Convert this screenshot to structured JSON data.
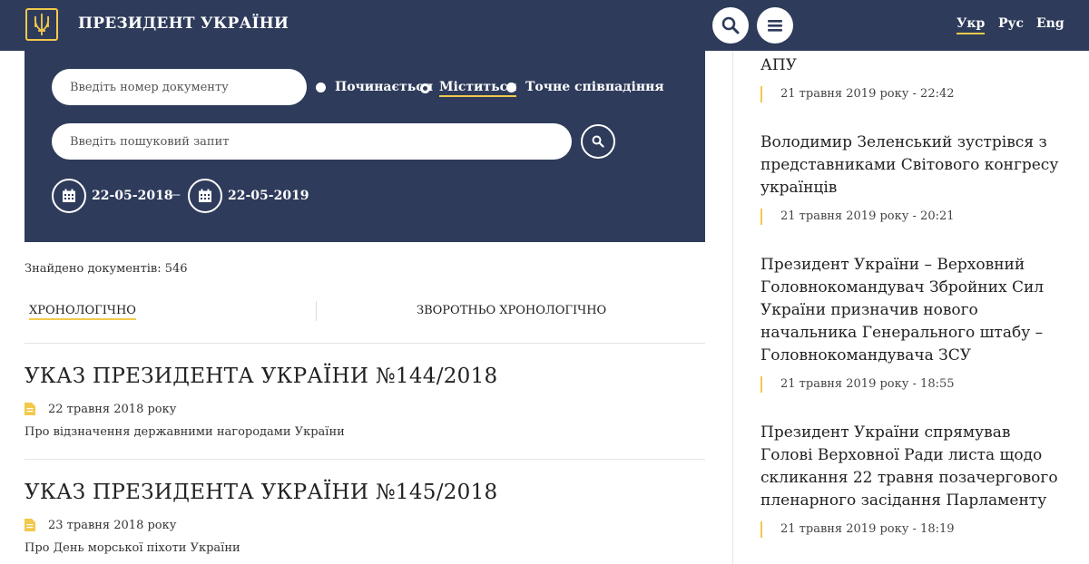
{
  "header": {
    "site_title": "ПРЕЗИДЕНТ УКРАЇНИ",
    "languages": [
      "Укр",
      "Рус",
      "Eng"
    ],
    "active_language": "Укр",
    "icons": {
      "search": "search-icon",
      "menu": "menu-icon",
      "logo": "trident-icon"
    }
  },
  "search": {
    "doc_number_placeholder": "Введіть номер документу",
    "query_placeholder": "Введіть пошуковий запит",
    "match_options": [
      "Починається",
      "Міститься",
      "Точне співпадіння"
    ],
    "selected_match": "Міститься",
    "date_from": "22-05-2018",
    "date_to": "22-05-2019",
    "date_separator": "—"
  },
  "results": {
    "found_label": "Знайдено документів: 546",
    "sort_options": [
      "ХРОНОЛОГІЧНО",
      "ЗВОРОТНЬО ХРОНОЛОГІЧНО"
    ],
    "active_sort": "ХРОНОЛОГІЧНО",
    "documents": [
      {
        "title": "УКАЗ ПРЕЗИДЕНТА УКРАЇНИ №144/2018",
        "date": "22 травня 2018 року",
        "description": "Про відзначення державними нагородами України"
      },
      {
        "title": "УКАЗ ПРЕЗИДЕНТА УКРАЇНИ №145/2018",
        "date": "23 травня 2018 року",
        "description": "Про День морської піхоти України"
      }
    ]
  },
  "news": [
    {
      "title": "АПУ",
      "time": "21 травня 2019 року - 22:42"
    },
    {
      "title": "Володимир Зеленський зустрівся з представниками Світового конгресу українців",
      "time": "21 травня 2019 року - 20:21"
    },
    {
      "title": "Президент України – Верховний Головнокомандувач Збройних Сил України призначив нового начальника Генерального штабу – Головнокомандувача ЗСУ",
      "time": "21 травня 2019 року - 18:55"
    },
    {
      "title": "Президент України спрямував Голові Верховної Ради листа щодо скликання 22 травня позачергового пленарного засідання Парламенту",
      "time": "21 травня 2019 року - 18:19"
    }
  ],
  "colors": {
    "navy": "#2e3b5b",
    "accent": "#f2c94c"
  }
}
